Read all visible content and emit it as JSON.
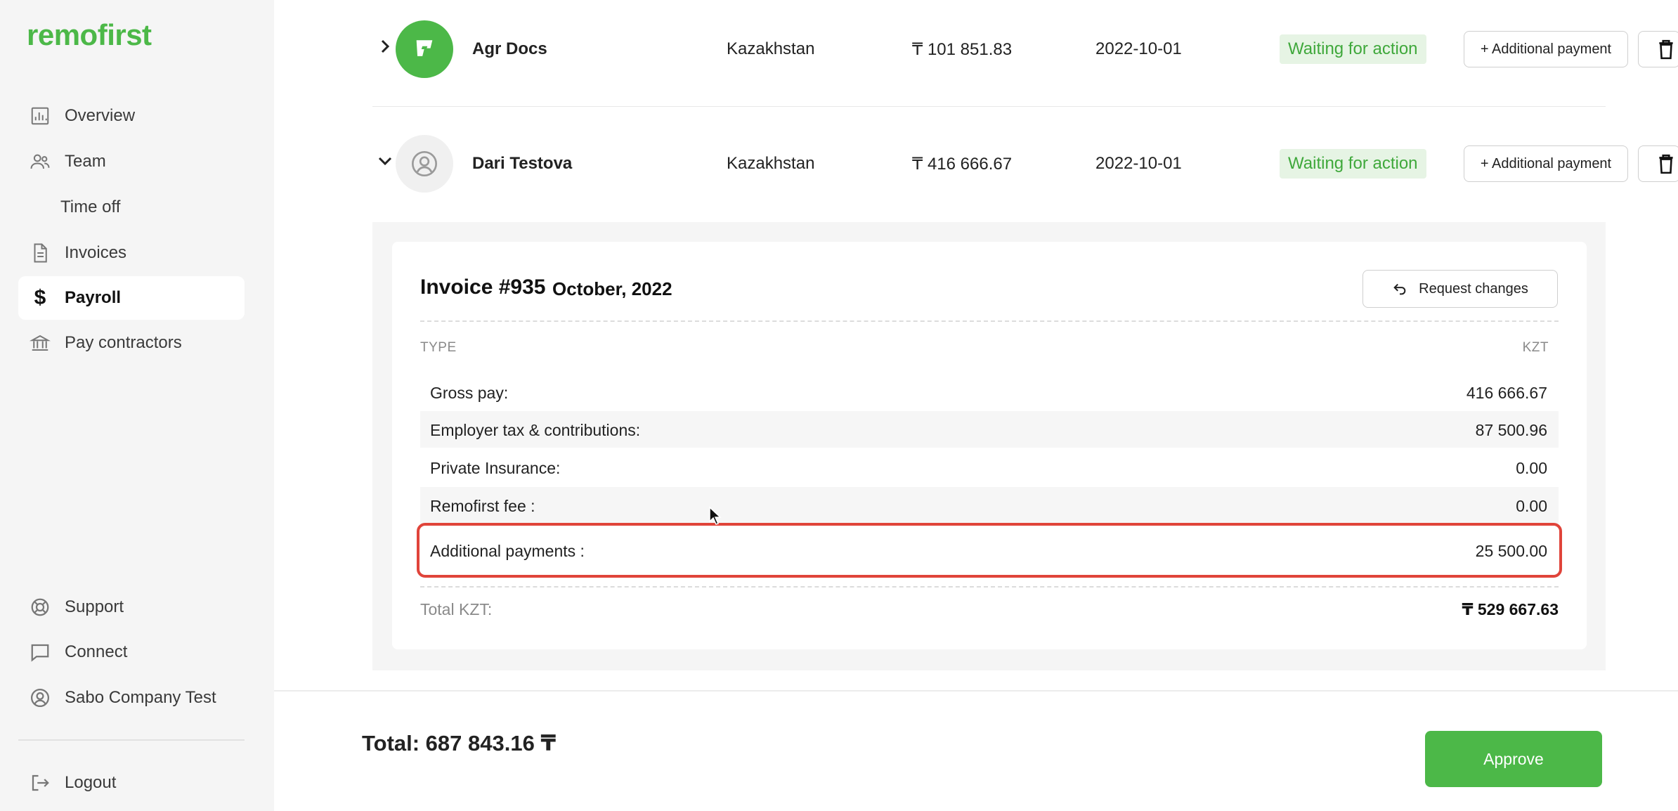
{
  "brand": {
    "logo_text": "remofirst",
    "accent": "#4cb848"
  },
  "sidebar": {
    "items": [
      {
        "label": "Overview",
        "icon": "chart-icon"
      },
      {
        "label": "Team",
        "icon": "people-icon"
      },
      {
        "label": "Time off",
        "icon": ""
      },
      {
        "label": "Invoices",
        "icon": "document-icon"
      },
      {
        "label": "Payroll",
        "icon": "dollar-icon",
        "active": true
      },
      {
        "label": "Pay contractors",
        "icon": "bank-icon"
      }
    ],
    "bottom_items": [
      {
        "label": "Support",
        "icon": "lifebuoy-icon"
      },
      {
        "label": "Connect",
        "icon": "chat-icon"
      },
      {
        "label": "Sabo Company Test",
        "icon": "user-circle-icon"
      },
      {
        "label": "Logout",
        "icon": "logout-icon"
      }
    ]
  },
  "rows": [
    {
      "name": "Agr Docs",
      "country": "Kazakhstan",
      "amount": "₸ 101 851.83",
      "date": "2022-10-01",
      "status": "Waiting for action",
      "add_payment_label": "+ Additional payment",
      "expanded": false
    },
    {
      "name": "Dari Testova",
      "country": "Kazakhstan",
      "amount": "₸ 416 666.67",
      "date": "2022-10-01",
      "status": "Waiting for action",
      "add_payment_label": "+ Additional payment",
      "expanded": true
    }
  ],
  "invoice": {
    "title": "Invoice #935",
    "month": "October, 2022",
    "request_changes_label": "Request changes",
    "col_type": "TYPE",
    "col_currency": "KZT",
    "lines": [
      {
        "label": "Gross pay:",
        "value": "416 666.67"
      },
      {
        "label": "Employer tax & contributions:",
        "value": "87 500.96"
      },
      {
        "label": "Private Insurance:",
        "value": "0.00"
      },
      {
        "label": "Remofirst fee :",
        "value": "0.00"
      },
      {
        "label": "Additional payments :",
        "value": "25 500.00"
      }
    ],
    "total_label": "Total KZT:",
    "total_value": "₸ 529 667.63"
  },
  "footer": {
    "total_text": "Total: 687 843.16 ₸",
    "approve_label": "Approve"
  },
  "colors": {
    "status_bg": "#e6f4e4",
    "status_fg": "#3fa83b",
    "highlight": "#e0443a"
  }
}
